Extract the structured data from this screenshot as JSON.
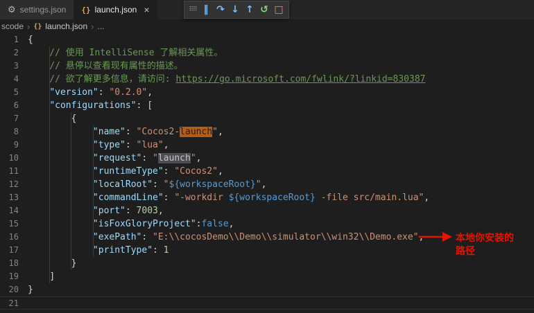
{
  "theme": {
    "editor_bg": "#1e1e1e",
    "tabbar_bg": "#252526",
    "inactive_tab_bg": "#2d2d2d",
    "comment": "#6a9955",
    "key": "#9cdcfe",
    "string": "#ce9178",
    "number": "#b5cea8",
    "keyword": "#569cd6",
    "line_number": "#858585",
    "annotation_red": "#e51400"
  },
  "tab_bar": {
    "tabs": [
      {
        "label": "settings.json",
        "icon": "gear-icon",
        "icon_glyph": "⚙",
        "active": false
      },
      {
        "label": "launch.json",
        "icon": "json-braces-icon",
        "icon_glyph": "{}",
        "active": true,
        "close_glyph": "×"
      }
    ]
  },
  "debug_toolbar": {
    "icons": [
      {
        "name": "drag-handle-icon",
        "glyph": "⠿⠿",
        "color": "#9a9a9a",
        "small": true
      },
      {
        "name": "pause-icon",
        "glyph": "‖",
        "color": "#75beff"
      },
      {
        "name": "step-over-icon",
        "glyph": "↷",
        "color": "#75beff"
      },
      {
        "name": "step-into-icon",
        "glyph": "↓",
        "color": "#75beff"
      },
      {
        "name": "step-out-icon",
        "glyph": "↑",
        "color": "#75beff"
      },
      {
        "name": "restart-icon",
        "glyph": "↺",
        "color": "#89d185"
      },
      {
        "name": "stop-icon",
        "glyph": "□",
        "color": "#f48771"
      }
    ]
  },
  "breadcrumb": {
    "folder": "scode",
    "separator": "›",
    "file_icon_glyph": "{}",
    "file": "launch.json",
    "more": "..."
  },
  "editor": {
    "lines": [
      {
        "n": 1,
        "t": [
          [
            "p",
            "{"
          ]
        ]
      },
      {
        "n": 2,
        "t": [
          [
            "c",
            "    // 使用 IntelliSense 了解相关属性。"
          ]
        ]
      },
      {
        "n": 3,
        "t": [
          [
            "c",
            "    // 悬停以查看现有属性的描述。"
          ]
        ]
      },
      {
        "n": 4,
        "t": [
          [
            "c",
            "    // 欲了解更多信息，请访问: "
          ],
          [
            "l",
            "https://go.microsoft.com/fwlink/?linkid=830387"
          ]
        ]
      },
      {
        "n": 5,
        "t": [
          [
            "w",
            "    "
          ],
          [
            "k",
            "\"version\""
          ],
          [
            "p",
            ": "
          ],
          [
            "s",
            "\"0.2.0\""
          ],
          [
            "p",
            ","
          ]
        ]
      },
      {
        "n": 6,
        "t": [
          [
            "w",
            "    "
          ],
          [
            "k",
            "\"configurations\""
          ],
          [
            "p",
            ": ["
          ]
        ]
      },
      {
        "n": 7,
        "t": [
          [
            "w",
            "        "
          ],
          [
            "p",
            "{"
          ]
        ]
      },
      {
        "n": 8,
        "t": [
          [
            "w",
            "            "
          ],
          [
            "k",
            "\"name\""
          ],
          [
            "p",
            ": "
          ],
          [
            "s",
            "\"Cocos2-"
          ],
          [
            "so",
            "launch"
          ],
          [
            "s",
            "\""
          ],
          [
            "p",
            ","
          ]
        ]
      },
      {
        "n": 9,
        "t": [
          [
            "w",
            "            "
          ],
          [
            "k",
            "\"type\""
          ],
          [
            "p",
            ": "
          ],
          [
            "s",
            "\"lua\""
          ],
          [
            "p",
            ","
          ]
        ]
      },
      {
        "n": 10,
        "t": [
          [
            "w",
            "            "
          ],
          [
            "k",
            "\"request\""
          ],
          [
            "p",
            ": "
          ],
          [
            "s",
            "\""
          ],
          [
            "sg",
            "launch"
          ],
          [
            "s",
            "\""
          ],
          [
            "p",
            ","
          ]
        ]
      },
      {
        "n": 11,
        "t": [
          [
            "w",
            "            "
          ],
          [
            "k",
            "\"runtimeType\""
          ],
          [
            "p",
            ": "
          ],
          [
            "s",
            "\"Cocos2\""
          ],
          [
            "p",
            ","
          ]
        ]
      },
      {
        "n": 12,
        "t": [
          [
            "w",
            "            "
          ],
          [
            "k",
            "\"localRoot\""
          ],
          [
            "p",
            ": "
          ],
          [
            "s",
            "\""
          ],
          [
            "v",
            "${workspaceRoot}"
          ],
          [
            "s",
            "\""
          ],
          [
            "p",
            ","
          ]
        ]
      },
      {
        "n": 13,
        "t": [
          [
            "w",
            "            "
          ],
          [
            "k",
            "\"commandLine\""
          ],
          [
            "p",
            ": "
          ],
          [
            "s",
            "\"-workdir "
          ],
          [
            "v",
            "${workspaceRoot}"
          ],
          [
            "s",
            " -file src/main.lua\""
          ],
          [
            "p",
            ","
          ]
        ]
      },
      {
        "n": 14,
        "t": [
          [
            "w",
            "            "
          ],
          [
            "k",
            "\"port\""
          ],
          [
            "p",
            ": "
          ],
          [
            "n2",
            "7003"
          ],
          [
            "p",
            ","
          ]
        ]
      },
      {
        "n": 15,
        "t": [
          [
            "w",
            "            "
          ],
          [
            "k",
            "\"isFoxGloryProject\""
          ],
          [
            "p",
            ":"
          ],
          [
            "b",
            "false"
          ],
          [
            "p",
            ","
          ]
        ]
      },
      {
        "n": 16,
        "t": [
          [
            "w",
            "            "
          ],
          [
            "k",
            "\"exePath\""
          ],
          [
            "p",
            ": "
          ],
          [
            "s",
            "\"E:\\\\cocosDemo\\\\Demo\\\\simulator\\\\win32\\\\Demo.exe\""
          ],
          [
            "p",
            ","
          ]
        ]
      },
      {
        "n": 17,
        "t": [
          [
            "w",
            "            "
          ],
          [
            "k",
            "\"printType\""
          ],
          [
            "p",
            ": "
          ],
          [
            "n2",
            "1"
          ]
        ]
      },
      {
        "n": 18,
        "t": [
          [
            "w",
            "        "
          ],
          [
            "p",
            "}"
          ]
        ]
      },
      {
        "n": 19,
        "t": [
          [
            "w",
            "    "
          ],
          [
            "p",
            "]"
          ]
        ]
      },
      {
        "n": 20,
        "t": [
          [
            "p",
            "}"
          ]
        ]
      },
      {
        "n": 21,
        "t": [],
        "cur": true
      }
    ],
    "annotation": {
      "line1": "本地你安装的",
      "line2": "路径",
      "color": "#e51400"
    }
  }
}
